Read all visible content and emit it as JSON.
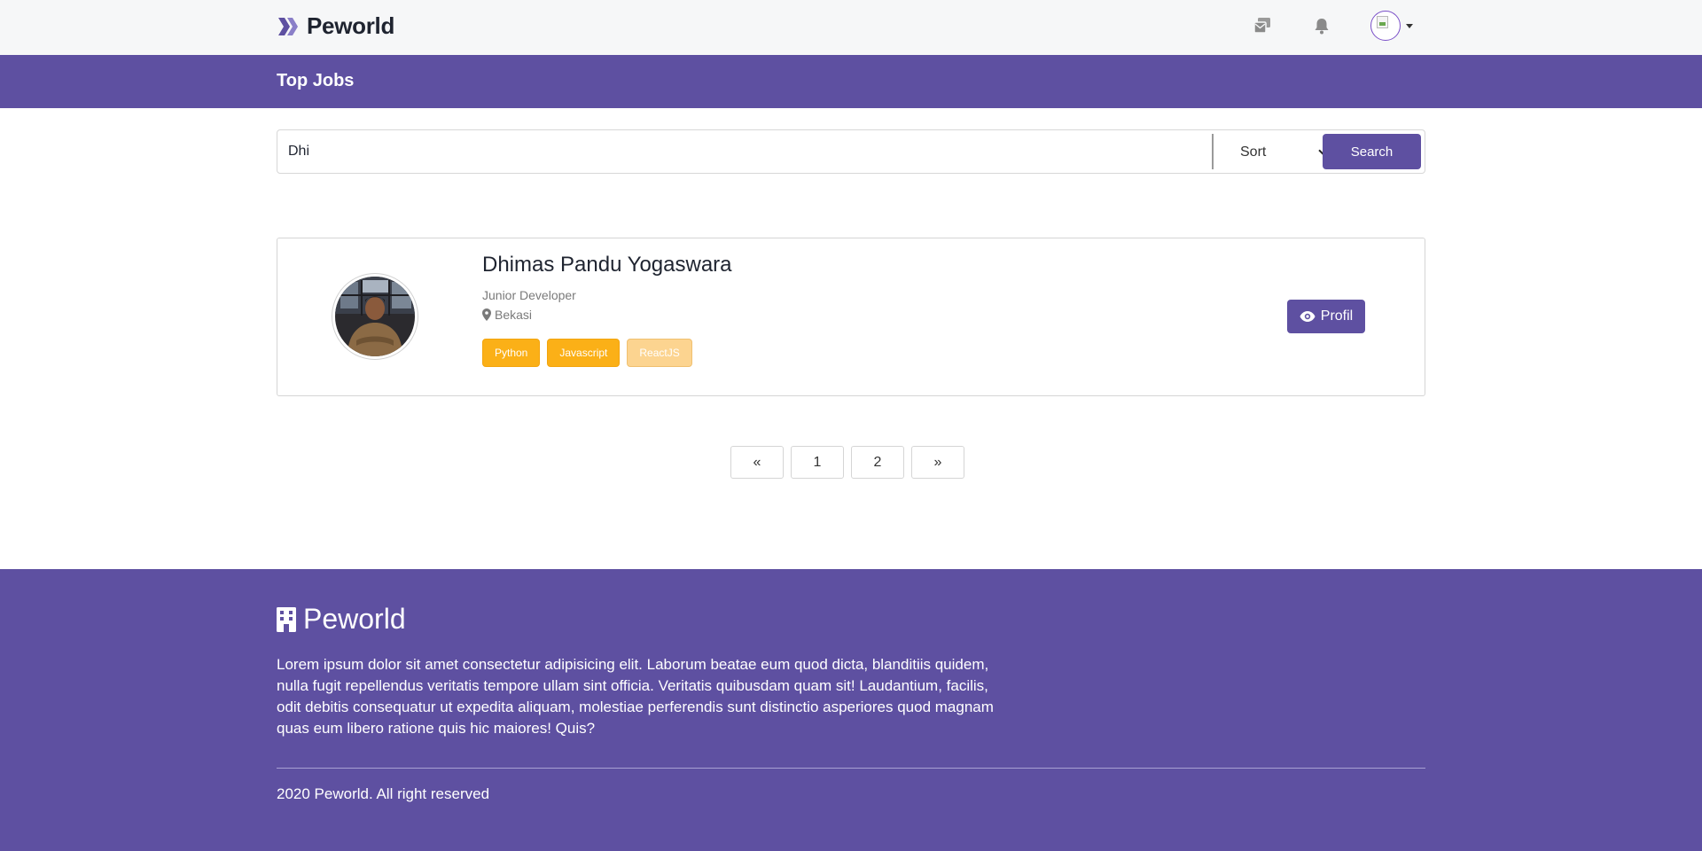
{
  "header": {
    "brand": "Peworld",
    "accent_color": "#5e50a1",
    "icons": [
      "mail-icon",
      "bell-icon"
    ],
    "avatar_icon": "broken-image-icon"
  },
  "title_bar": {
    "title": "Top Jobs"
  },
  "search": {
    "value": "Dhi",
    "sort_label": "Sort",
    "button_label": "Search"
  },
  "results": [
    {
      "name": "Dhimas Pandu Yogaswara",
      "role": "Junior Developer",
      "location": "Bekasi",
      "skills": [
        "Python",
        "Javascript",
        "ReactJS"
      ],
      "skill_color": "#fbb017",
      "profile_button": "Profil"
    }
  ],
  "pagination": {
    "prev": "«",
    "pages": [
      "1",
      "2"
    ],
    "next": "»"
  },
  "footer": {
    "brand": "Peworld",
    "description": "Lorem ipsum dolor sit amet consectetur adipisicing elit. Laborum beatae eum quod dicta, blanditiis quidem, nulla fugit repellendus veritatis tempore ullam sint officia. Veritatis quibusdam quam sit! Laudantium, facilis, odit debitis consequatur ut expedita aliquam, molestiae perferendis sunt distinctio asperiores quod magnam quas eum libero ratione quis hic maiores! Quis?",
    "copyright": "2020 Peworld. All right reserved"
  }
}
